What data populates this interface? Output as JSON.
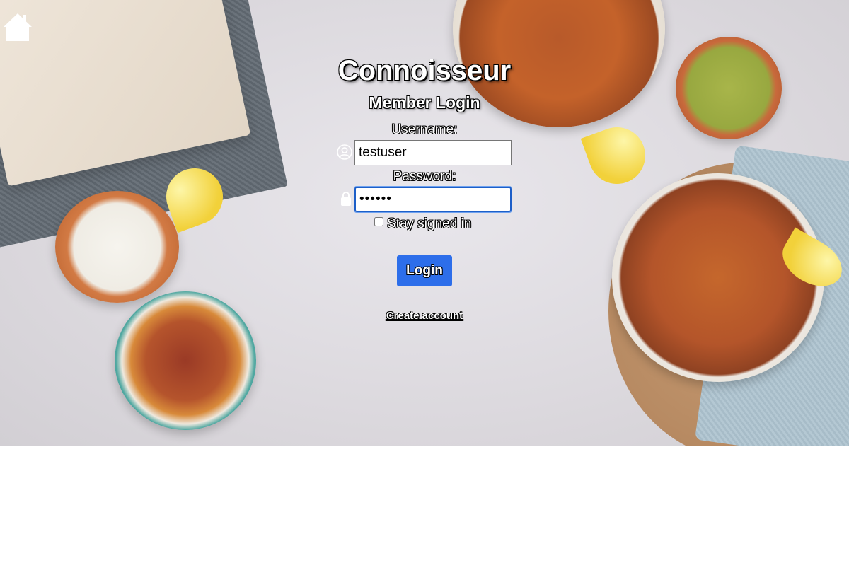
{
  "app": {
    "title": "Connoisseur",
    "subtitle": "Member Login"
  },
  "form": {
    "username_label": "Username:",
    "username_value": "testuser",
    "password_label": "Password:",
    "password_value": "••••••",
    "stay_signed_in_label": "Stay signed in",
    "stay_signed_in_checked": false,
    "login_button_label": "Login",
    "create_account_link": "Create account"
  },
  "icons": {
    "home": "home-icon",
    "user": "user-icon",
    "password": "lock-icon"
  },
  "colors": {
    "login_button": "#2d6eea",
    "focused_input_border": "#1d5fc8",
    "text": "#ffffff",
    "text_outline": "#000000"
  }
}
